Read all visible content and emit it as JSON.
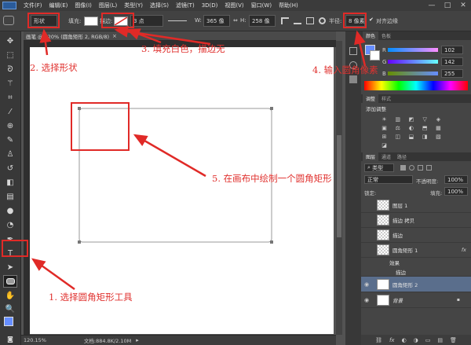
{
  "menubar": {
    "items": [
      "文件(F)",
      "编辑(E)",
      "图像(I)",
      "图层(L)",
      "类型(Y)",
      "选择(S)",
      "滤镜(T)",
      "3D(D)",
      "视图(V)",
      "窗口(W)",
      "帮助(H)"
    ],
    "win_min": "—",
    "win_max": "□",
    "win_close": "✕"
  },
  "options": {
    "mode": "形状",
    "fill_label": "填充:",
    "stroke_label": "描边:",
    "stroke_width": "3 点",
    "w_label": "W:",
    "w_value": "365 像",
    "link": "⇔",
    "h_label": "H:",
    "h_value": "258 像",
    "radius_label": "半径:",
    "radius_value": "8 像素",
    "align_edges": "对齐边缘",
    "align_checked": "✔"
  },
  "document": {
    "tab": "画笔 @ 120% (圆角矩形 2, RGB/8)",
    "tab_close": "×",
    "zoom": "120.15%",
    "doc_info": "文档:884.8K/2.10M"
  },
  "annotations": {
    "a1": "1. 选择圆角矩形工具",
    "a2": "2. 选择形状",
    "a3": "3. 填充白色，描边无",
    "a4": "4. 输入圆角像素",
    "a5": "5. 在画布中绘制一个圆角矩形"
  },
  "color_panel": {
    "tabs": [
      "颜色",
      "色板"
    ],
    "r_label": "R",
    "g_label": "G",
    "b_label": "B",
    "r": "102",
    "g": "142",
    "b": "255",
    "fg_color": "#668eff"
  },
  "adjust_panel": {
    "tabs": [
      "调整",
      "样式"
    ],
    "title": "添加调整",
    "icons": [
      "☀",
      "▥",
      "◩",
      "▽",
      "◈",
      "▣",
      "⚖",
      "◐",
      "⬒",
      "▦",
      "⊞",
      "◫",
      "⬓",
      "◨",
      "▧",
      "◪"
    ]
  },
  "layers_panel": {
    "tabs": [
      "图层",
      "通道",
      "路径"
    ],
    "filter": "类型",
    "blend_mode": "正常",
    "opacity_label": "不透明度:",
    "opacity": "100%",
    "lock_label": "锁定:",
    "fill_label": "填充:",
    "fill": "100%",
    "layers": [
      {
        "name": "图层 1",
        "eye": ""
      },
      {
        "name": "描边 拷贝",
        "eye": ""
      },
      {
        "name": "描边",
        "eye": ""
      },
      {
        "name": "圆角矩形 1",
        "eye": "",
        "fx": "fx"
      },
      {
        "name": "效果",
        "eye": "",
        "sub": true
      },
      {
        "name": "描边",
        "eye": "",
        "sub": true
      },
      {
        "name": "圆角矩形 2",
        "eye": "◉",
        "selected": true
      },
      {
        "name": "背景",
        "eye": "◉",
        "lock": "🔒"
      }
    ],
    "footer_icons": [
      "⛓",
      "fx",
      "◐",
      "◑",
      "▭",
      "▤",
      "🗑"
    ]
  },
  "colors": {
    "annotation_red": "#e0322f",
    "selected_layer": "#5a6e8c"
  }
}
